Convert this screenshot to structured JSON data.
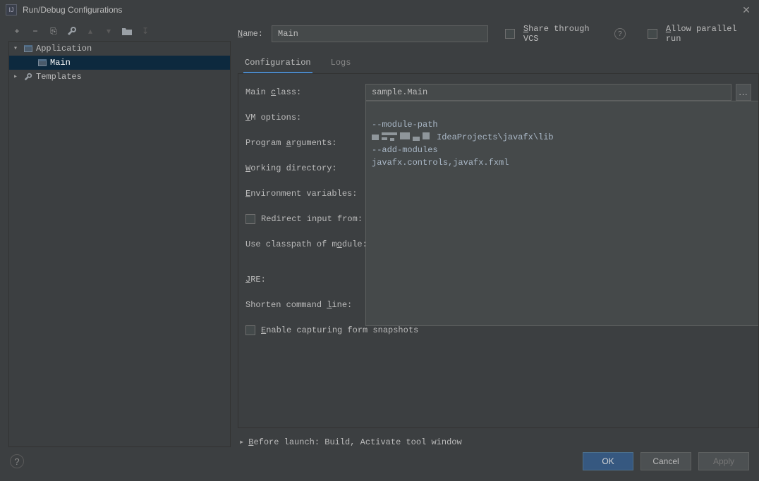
{
  "window": {
    "title": "Run/Debug Configurations"
  },
  "toolbar": {
    "add": "+",
    "remove": "−",
    "copy": "⎘",
    "wrench": "🔧",
    "up": "▴",
    "down": "▾",
    "folder": "▣",
    "sort": "↧"
  },
  "tree": {
    "application": "Application",
    "main": "Main",
    "templates": "Templates"
  },
  "nameRow": {
    "label": "Name:",
    "value": "Main",
    "share_prefix": "S",
    "share_rest": "hare through VCS",
    "allow_prefix": "A",
    "allow_rest": "llow parallel run"
  },
  "tabs": {
    "configuration": "Configuration",
    "logs": "Logs"
  },
  "form": {
    "main_class": {
      "label": "Main class:",
      "value": "sample.Main",
      "u": "c"
    },
    "vm_options": {
      "label": "VM options:",
      "u": "V"
    },
    "program_args": {
      "label": "Program arguments:",
      "u": "a"
    },
    "working_dir": {
      "label": "Working directory:",
      "u": "W"
    },
    "env_vars": {
      "label": "Environment variables:",
      "u": "E"
    },
    "redirect": {
      "label": "Redirect input from:"
    },
    "classpath": {
      "label": "Use classpath of module:",
      "u": "o"
    },
    "jre": {
      "label": "JRE:",
      "u": "J"
    },
    "shorten": {
      "label": "Shorten command line:",
      "u": "l"
    },
    "enable_snap": {
      "label_pre": "E",
      "label_rest": "nable capturing form snapshots"
    }
  },
  "vm_text": {
    "l1": "--module-path",
    "l2_tail": "IdeaProjects\\javafx\\lib",
    "l3": "--add-modules",
    "l4": "javafx.controls,javafx.fxml"
  },
  "before_launch": {
    "label_pre": "B",
    "label_rest": "efore launch: Build, Activate tool window"
  },
  "footer": {
    "ok": "OK",
    "cancel": "Cancel",
    "apply": "Apply"
  }
}
